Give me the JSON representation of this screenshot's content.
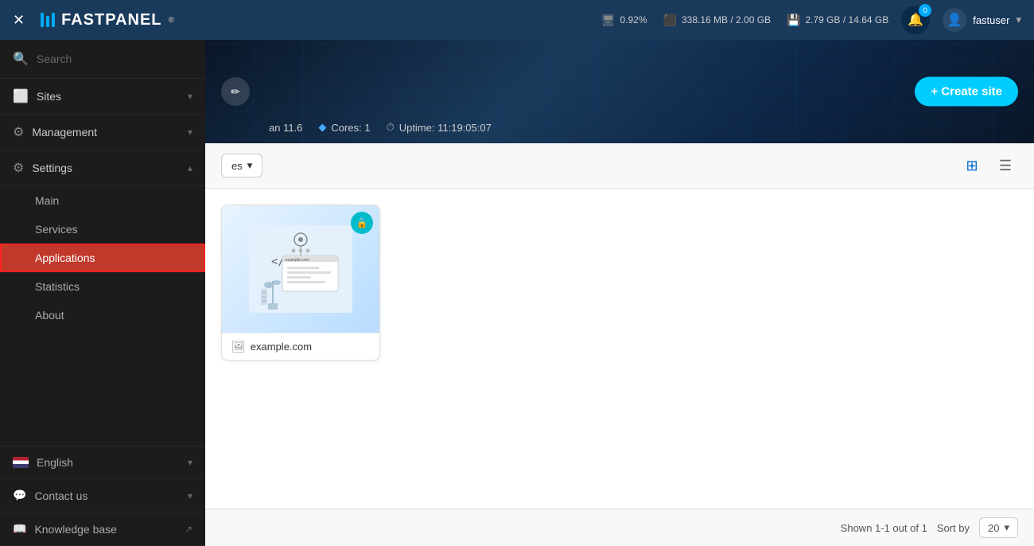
{
  "header": {
    "close_label": "✕",
    "logo_text": "FASTPANEL",
    "logo_tm": "®",
    "cpu_icon": "cpu",
    "cpu_value": "0.92%",
    "ram_icon": "ram",
    "ram_value": "338.16 MB / 2.00 GB",
    "disk_icon": "disk",
    "disk_value": "2.79 GB / 14.64 GB",
    "bell_icon": "bell",
    "bell_badge": "0",
    "username": "fastuser",
    "user_icon": "person"
  },
  "sidebar": {
    "search_placeholder": "Search",
    "nav_items": [
      {
        "id": "sites",
        "label": "Sites",
        "icon": "☰",
        "has_arrow": true
      },
      {
        "id": "management",
        "label": "Management",
        "icon": "⚙",
        "has_arrow": true
      },
      {
        "id": "settings",
        "label": "Settings",
        "icon": "⚙",
        "has_arrow": true,
        "expanded": true
      }
    ],
    "settings_sub": [
      {
        "id": "main",
        "label": "Main"
      },
      {
        "id": "services",
        "label": "Services"
      },
      {
        "id": "applications",
        "label": "Applications",
        "active": true
      },
      {
        "id": "statistics",
        "label": "Statistics"
      },
      {
        "id": "about",
        "label": "About"
      }
    ],
    "footer": [
      {
        "id": "english",
        "label": "English",
        "icon": "flag",
        "has_arrow": true
      },
      {
        "id": "contact",
        "label": "Contact us",
        "icon": "💬",
        "has_arrow": true
      },
      {
        "id": "knowledge",
        "label": "Knowledge base",
        "icon": "📖",
        "external": true
      }
    ]
  },
  "banner": {
    "edit_icon": "✏",
    "os_label": "an 11.6",
    "cores_label": "Cores: 1",
    "uptime_label": "Uptime: 11:19:05:07",
    "create_btn": "+ Create site"
  },
  "toolbar": {
    "dropdown_label": "es",
    "grid_view": "⊞",
    "list_view": "☰"
  },
  "sites": [
    {
      "id": "example-com",
      "name": "example.com",
      "has_lock": true,
      "icon": "🖼"
    }
  ],
  "footer_bar": {
    "shown_label": "Shown 1-1 out of 1",
    "sort_label": "Sort by",
    "sort_value": "20"
  }
}
